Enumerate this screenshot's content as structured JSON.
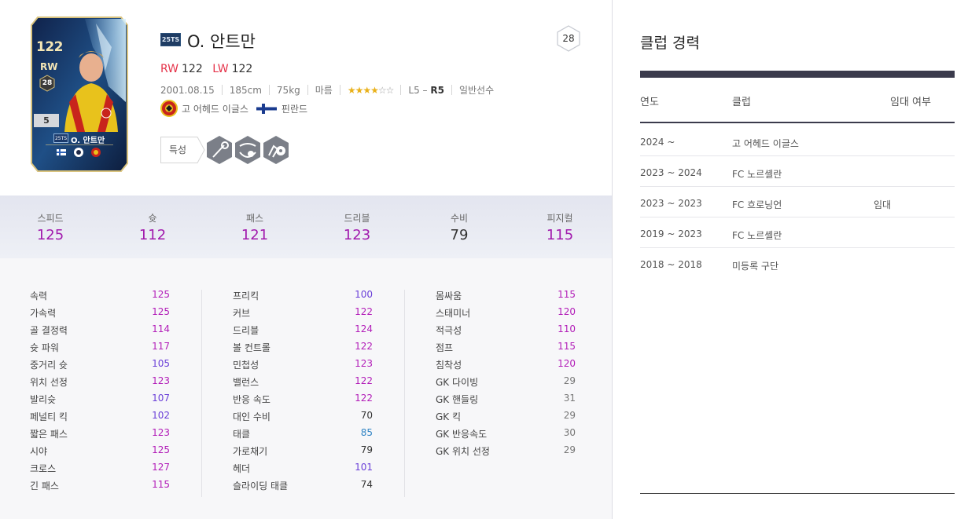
{
  "card": {
    "ovr": "122",
    "position": "RW",
    "level": "28",
    "grade": "5",
    "season": "25TS",
    "name": "O. 안트만"
  },
  "header": {
    "season_badge": "25TS",
    "player_name": "O. 안트만",
    "pay": "28"
  },
  "positions": [
    {
      "tag": "RW",
      "value": "122"
    },
    {
      "tag": "LW",
      "value": "122"
    }
  ],
  "info": {
    "birth": "2001.08.15",
    "height": "185cm",
    "weight": "75kg",
    "body": "마름",
    "stars_on": "★★★★",
    "stars_off": "☆☆",
    "foot_prefix": "L5 – ",
    "foot_bold": "R5",
    "type": "일반선수"
  },
  "club": {
    "club_name": "고 어헤드 이글스",
    "nation": "핀란드"
  },
  "traits": {
    "label": "특성",
    "icons": [
      "long-shot-trait-icon",
      "curl-trait-icon",
      "dribble-trait-icon"
    ]
  },
  "summary": [
    {
      "label": "스피드",
      "value": "125",
      "color": "#a11aad"
    },
    {
      "label": "슛",
      "value": "112",
      "color": "#a11aad"
    },
    {
      "label": "패스",
      "value": "121",
      "color": "#a11aad"
    },
    {
      "label": "드리블",
      "value": "123",
      "color": "#a11aad"
    },
    {
      "label": "수비",
      "value": "79",
      "color": "#333333"
    },
    {
      "label": "피지컬",
      "value": "115",
      "color": "#a11aad"
    }
  ],
  "columns": [
    [
      {
        "k": "속력",
        "v": "125",
        "c": "#b21db8"
      },
      {
        "k": "가속력",
        "v": "125",
        "c": "#b21db8"
      },
      {
        "k": "골 결정력",
        "v": "114",
        "c": "#b21db8"
      },
      {
        "k": "슛 파워",
        "v": "117",
        "c": "#b21db8"
      },
      {
        "k": "중거리 슛",
        "v": "105",
        "c": "#6a3fd8"
      },
      {
        "k": "위치 선정",
        "v": "123",
        "c": "#b21db8"
      },
      {
        "k": "발리슛",
        "v": "107",
        "c": "#6a3fd8"
      },
      {
        "k": "페널티 킥",
        "v": "102",
        "c": "#6a3fd8"
      },
      {
        "k": "짧은 패스",
        "v": "123",
        "c": "#b21db8"
      },
      {
        "k": "시야",
        "v": "125",
        "c": "#b21db8"
      },
      {
        "k": "크로스",
        "v": "127",
        "c": "#b21db8"
      },
      {
        "k": "긴 패스",
        "v": "115",
        "c": "#b21db8"
      }
    ],
    [
      {
        "k": "프리킥",
        "v": "100",
        "c": "#6a3fd8"
      },
      {
        "k": "커브",
        "v": "122",
        "c": "#b21db8"
      },
      {
        "k": "드리블",
        "v": "124",
        "c": "#b21db8"
      },
      {
        "k": "볼 컨트롤",
        "v": "122",
        "c": "#b21db8"
      },
      {
        "k": "민첩성",
        "v": "123",
        "c": "#b21db8"
      },
      {
        "k": "밸런스",
        "v": "122",
        "c": "#b21db8"
      },
      {
        "k": "반응 속도",
        "v": "122",
        "c": "#b21db8"
      },
      {
        "k": "대인 수비",
        "v": "70",
        "c": "#333333"
      },
      {
        "k": "태클",
        "v": "85",
        "c": "#2f83c4"
      },
      {
        "k": "가로채기",
        "v": "79",
        "c": "#333333"
      },
      {
        "k": "헤더",
        "v": "101",
        "c": "#6a3fd8"
      },
      {
        "k": "슬라이딩 태클",
        "v": "74",
        "c": "#333333"
      }
    ],
    [
      {
        "k": "몸싸움",
        "v": "115",
        "c": "#b21db8"
      },
      {
        "k": "스태미너",
        "v": "120",
        "c": "#b21db8"
      },
      {
        "k": "적극성",
        "v": "110",
        "c": "#b21db8"
      },
      {
        "k": "점프",
        "v": "115",
        "c": "#b21db8"
      },
      {
        "k": "침착성",
        "v": "120",
        "c": "#b21db8"
      },
      {
        "k": "GK 다이빙",
        "v": "29",
        "c": "#777777"
      },
      {
        "k": "GK 핸들링",
        "v": "31",
        "c": "#777777"
      },
      {
        "k": "GK 킥",
        "v": "29",
        "c": "#777777"
      },
      {
        "k": "GK 반응속도",
        "v": "30",
        "c": "#777777"
      },
      {
        "k": "GK 위치 선정",
        "v": "29",
        "c": "#777777"
      }
    ]
  ],
  "career": {
    "title": "클럽 경력",
    "headers": {
      "year": "연도",
      "club": "클럽",
      "loan": "임대 여부"
    },
    "rows": [
      {
        "year": "2024 ~",
        "club": "고 어헤드 이글스",
        "loan": ""
      },
      {
        "year": "2023 ~ 2024",
        "club": "FC 노르셸란",
        "loan": ""
      },
      {
        "year": "2023 ~ 2023",
        "club": "FC 흐로닝언",
        "loan": "임대"
      },
      {
        "year": "2019 ~ 2023",
        "club": "FC 노르셸란",
        "loan": ""
      },
      {
        "year": "2018 ~ 2018",
        "club": "미등록 구단",
        "loan": ""
      }
    ]
  }
}
